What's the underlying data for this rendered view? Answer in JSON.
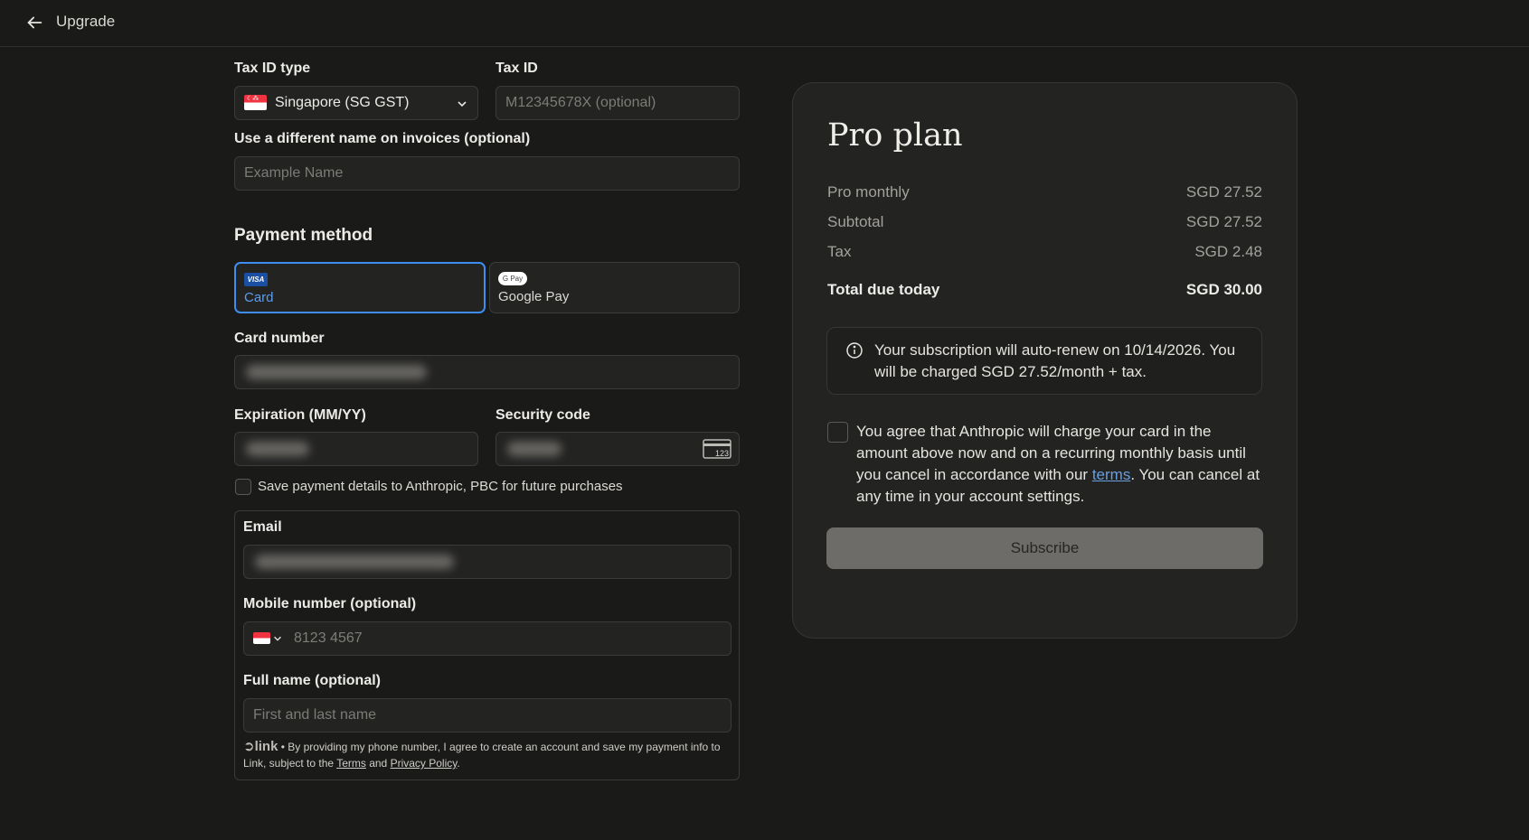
{
  "header": {
    "title": "Upgrade",
    "back_icon": "arrow-left-icon"
  },
  "tax": {
    "type_label": "Tax ID type",
    "type_value": "Singapore (SG GST)",
    "id_label": "Tax ID",
    "id_placeholder": "M12345678X (optional)"
  },
  "invoice_name": {
    "label": "Use a different name on invoices (optional)",
    "placeholder": "Example Name"
  },
  "payment": {
    "title": "Payment method",
    "options": [
      {
        "label": "Card",
        "badge": "VISA",
        "selected": true
      },
      {
        "label": "Google Pay",
        "badge": "G Pay",
        "selected": false
      }
    ],
    "card_number_label": "Card number",
    "expiration_label": "Expiration (MM/YY)",
    "security_label": "Security code",
    "security_icon_text": "123",
    "save_details": "Save payment details to Anthropic, PBC for future purchases"
  },
  "link": {
    "email_label": "Email",
    "mobile_label": "Mobile number (optional)",
    "mobile_placeholder": "8123 4567",
    "fullname_label": "Full name (optional)",
    "fullname_placeholder": "First and last name",
    "logo_text": "link",
    "footnote_prefix": " • By providing my phone number, I agree to create an account and save my payment info to Link, subject to the ",
    "terms": "Terms",
    "and": " and ",
    "privacy": "Privacy Policy",
    "period": "."
  },
  "summary": {
    "plan_title": "Pro plan",
    "rows": [
      {
        "label": "Pro monthly",
        "value": "SGD 27.52"
      },
      {
        "label": "Subtotal",
        "value": "SGD 27.52"
      },
      {
        "label": "Tax",
        "value": "SGD 2.48"
      }
    ],
    "total_label": "Total due today",
    "total_value": "SGD 30.00",
    "notice": "Your subscription will auto-renew on 10/14/2026. You will be charged SGD 27.52/month + tax.",
    "agree_prefix": "You agree that Anthropic will charge your card in the amount above now and on a recurring monthly basis until you cancel in accordance with our ",
    "agree_link": "terms",
    "agree_suffix": ". You can cancel at any time in your account settings.",
    "subscribe_label": "Subscribe"
  },
  "colors": {
    "accent": "#3d8ef0",
    "background": "#1a1a19",
    "card": "#232322",
    "link": "#6a9fe0"
  }
}
